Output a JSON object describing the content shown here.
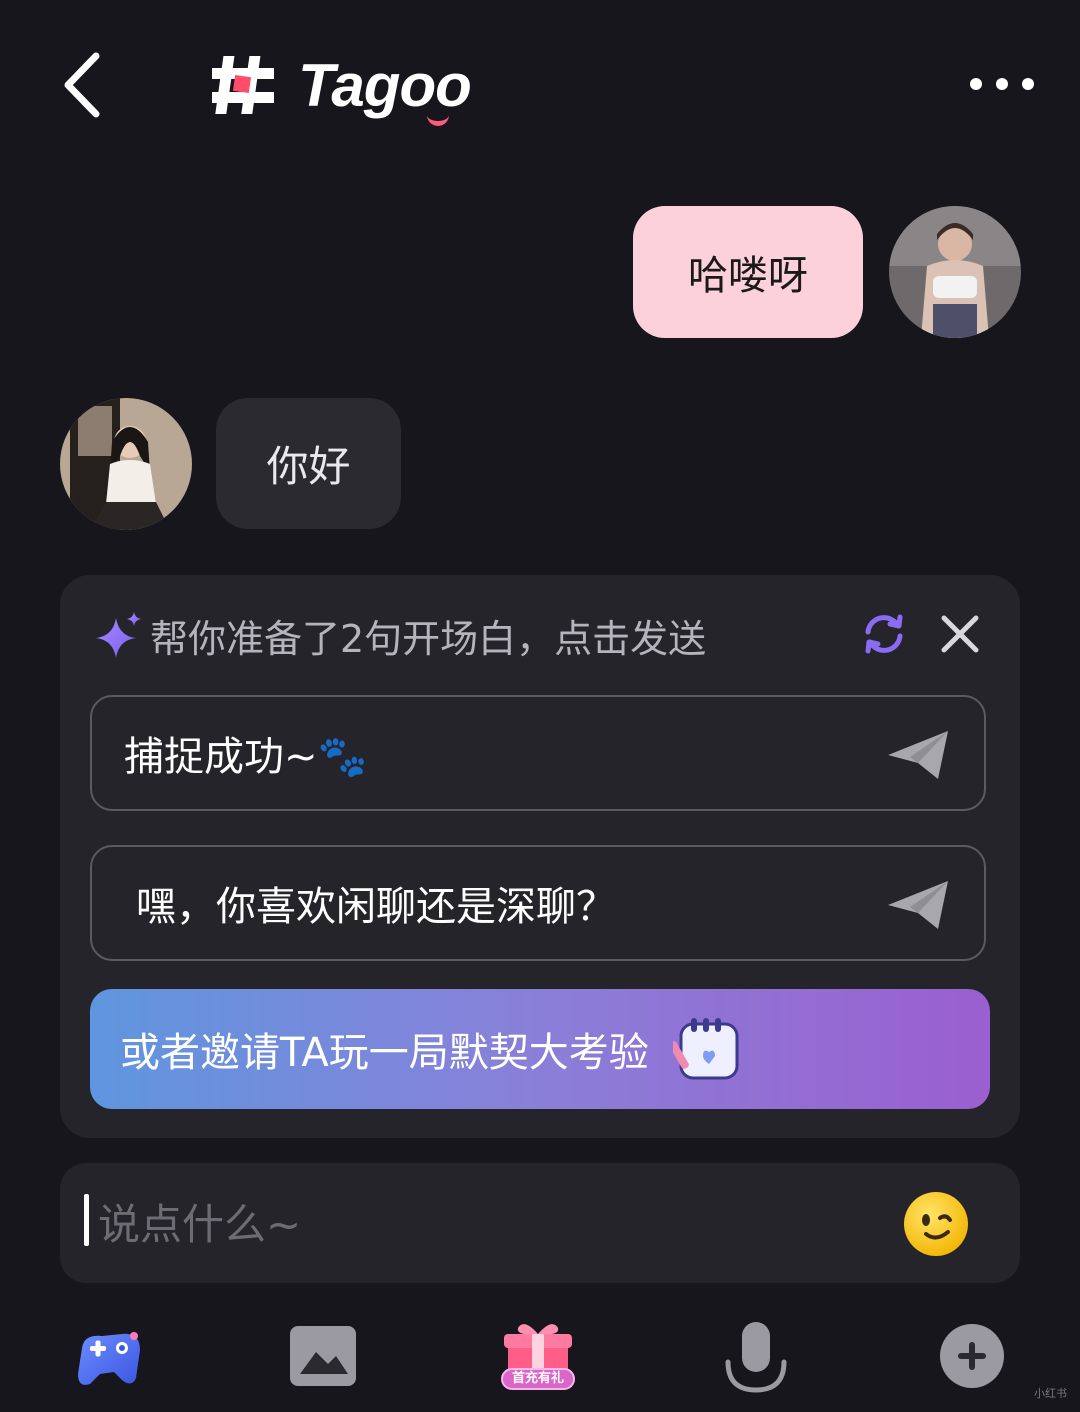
{
  "header": {
    "logo_text": "Tagoo"
  },
  "messages": [
    {
      "side": "me",
      "text": "哈喽呀"
    },
    {
      "side": "other",
      "text": "你好"
    }
  ],
  "opener_panel": {
    "title": "帮你准备了2句开场白，点击发送",
    "options": [
      {
        "text": "捕捉成功~🐾"
      },
      {
        "text": "嘿，你喜欢闲聊还是深聊？"
      }
    ],
    "invite_text": "或者邀请TA玩一局默契大考验"
  },
  "input": {
    "placeholder": "说点什么~",
    "value": ""
  },
  "toolbar": {
    "gift_badge": "首充有礼"
  },
  "watermark": "小红书",
  "colors": {
    "background": "#17161c",
    "my_bubble": "#fdd1da",
    "other_bubble": "#2b2a31",
    "panel": "#25242b",
    "accent_purple": "#8a5cf0"
  }
}
